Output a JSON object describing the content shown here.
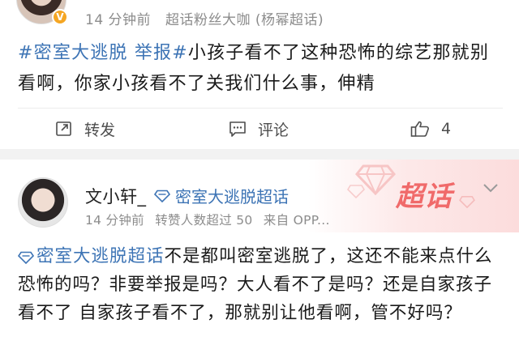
{
  "post1": {
    "time": "14 分钟前",
    "source": "超话粉丝大咖 (杨幂超话)",
    "hashtag": "#密室大逃脱 举报#",
    "text": "小孩子看不了这种恐怖的综艺那就别看啊，你家小孩看不了关我们什么事，伸精",
    "actions": {
      "repost_label": "转发",
      "comment_label": "评论",
      "like_count": "4"
    }
  },
  "post2": {
    "username": "文小轩_",
    "supertopic": "密室大逃脱超话",
    "badge": "超话",
    "time": "14 分钟前",
    "repost_info": "转赞人数超过 50",
    "source": "来自 OPP...",
    "body_tag": "密室大逃脱超话",
    "text": "不是都叫密室逃脱了，这还不能来点什么恐怖的吗？非要举报是吗？大人看不了是吗？还是自家孩子看不了 自家孩子看不了，那就别让他看啊，管不好吗？"
  },
  "colors": {
    "link": "#3d74b5",
    "badge": "#f06a6a",
    "muted": "#8c8c8c",
    "verified": "#f5a623"
  }
}
